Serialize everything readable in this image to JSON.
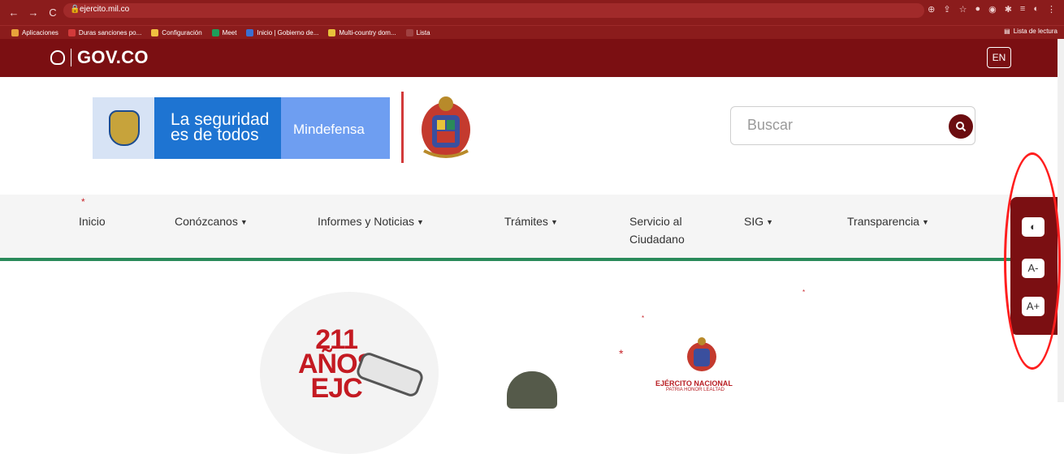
{
  "browser": {
    "url": "ejercito.mil.co",
    "bookmarks": [
      "Aplicaciones",
      "Duras sanciones po...",
      "Configuración",
      "Meet",
      "Inicio | Gobierno de...",
      "Multi-country dom...",
      "Lista"
    ],
    "reading_list": "Lista de lectura"
  },
  "govbar": {
    "logo": "GOV.CO",
    "lang": "EN"
  },
  "header": {
    "slogan_line1": "La seguridad",
    "slogan_line2": "es de todos",
    "ministry": "Mindefensa",
    "search_placeholder": "Buscar"
  },
  "nav": {
    "items": [
      {
        "label": "Inicio",
        "dropdown": false
      },
      {
        "label": "Conózcanos",
        "dropdown": true
      },
      {
        "label": "Informes y Noticias",
        "dropdown": true
      },
      {
        "label": "Trámites",
        "dropdown": true
      },
      {
        "label": "Servicio al",
        "label2": "Ciudadano",
        "dropdown": false
      },
      {
        "label": "SIG",
        "dropdown": true
      },
      {
        "label": "Transparencia",
        "dropdown": true
      }
    ]
  },
  "accessibility": {
    "contrast_icon": "contrast-icon",
    "decrease": "A-",
    "increase": "A+"
  },
  "hero": {
    "number": "211",
    "word": "AÑOS",
    "partial": "EJC",
    "title": "EJÉRCITO NACIONAL",
    "motto": "PATRIA HONOR LEALTAD"
  },
  "colors": {
    "brand": "#7b0f12",
    "accent_green": "#2a8a5a",
    "highlight": "#ff1e1e"
  }
}
